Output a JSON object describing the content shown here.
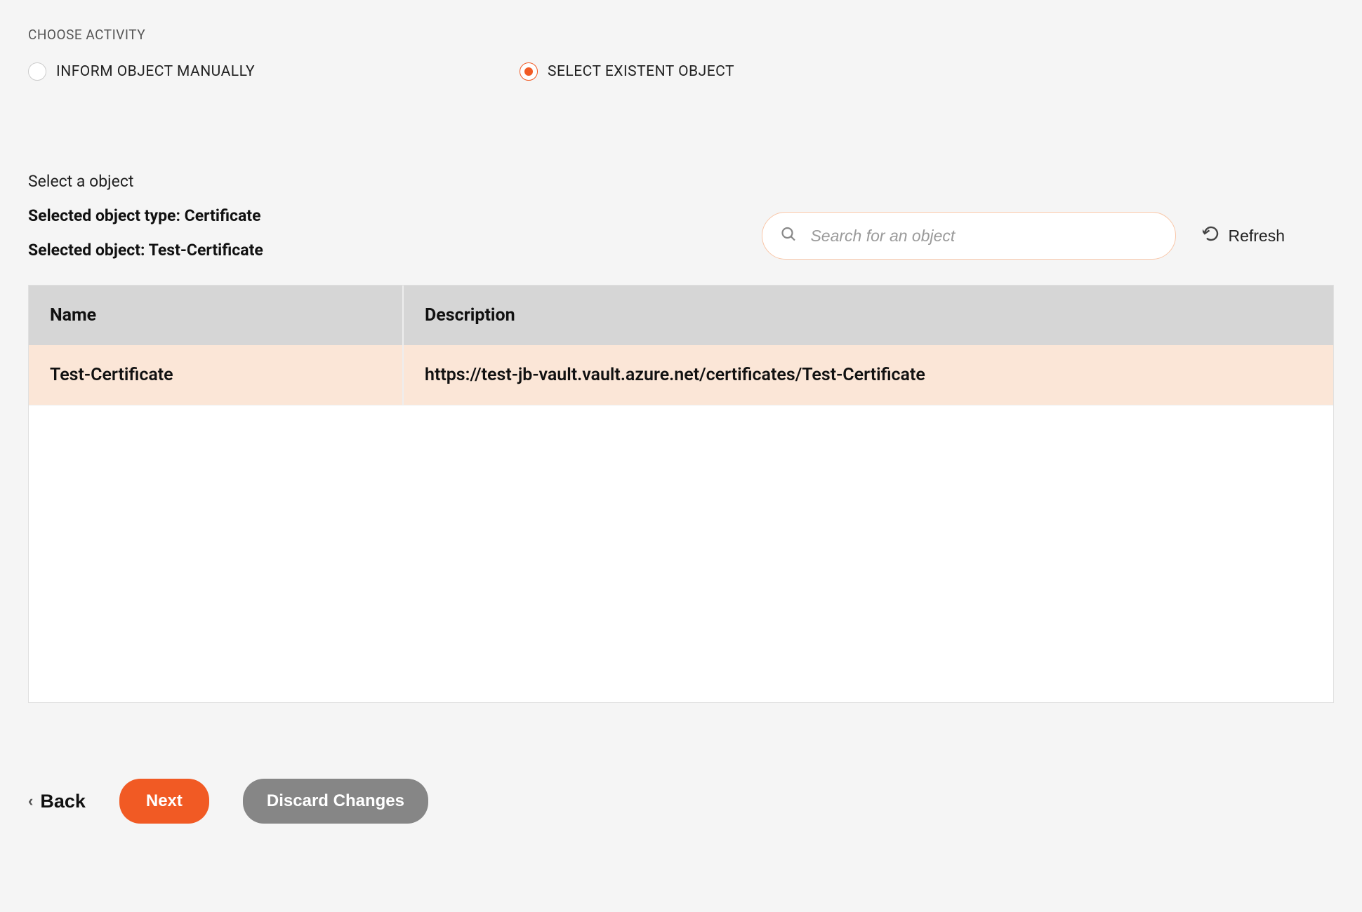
{
  "header": {
    "choose_activity_label": "CHOOSE ACTIVITY"
  },
  "activity_options": {
    "manual_label": "INFORM OBJECT MANUALLY",
    "select_label": "SELECT EXISTENT OBJECT"
  },
  "select_section": {
    "title": "Select a object",
    "selected_type_line": "Selected object type: Certificate",
    "selected_object_line": "Selected object: Test-Certificate"
  },
  "search": {
    "placeholder": "Search for an object"
  },
  "refresh_label": "Refresh",
  "table": {
    "headers": {
      "name": "Name",
      "description": "Description"
    },
    "rows": [
      {
        "name": "Test-Certificate",
        "description": "https://test-jb-vault.vault.azure.net/certificates/Test-Certificate"
      }
    ]
  },
  "footer": {
    "back": "Back",
    "next": "Next",
    "discard": "Discard Changes"
  }
}
